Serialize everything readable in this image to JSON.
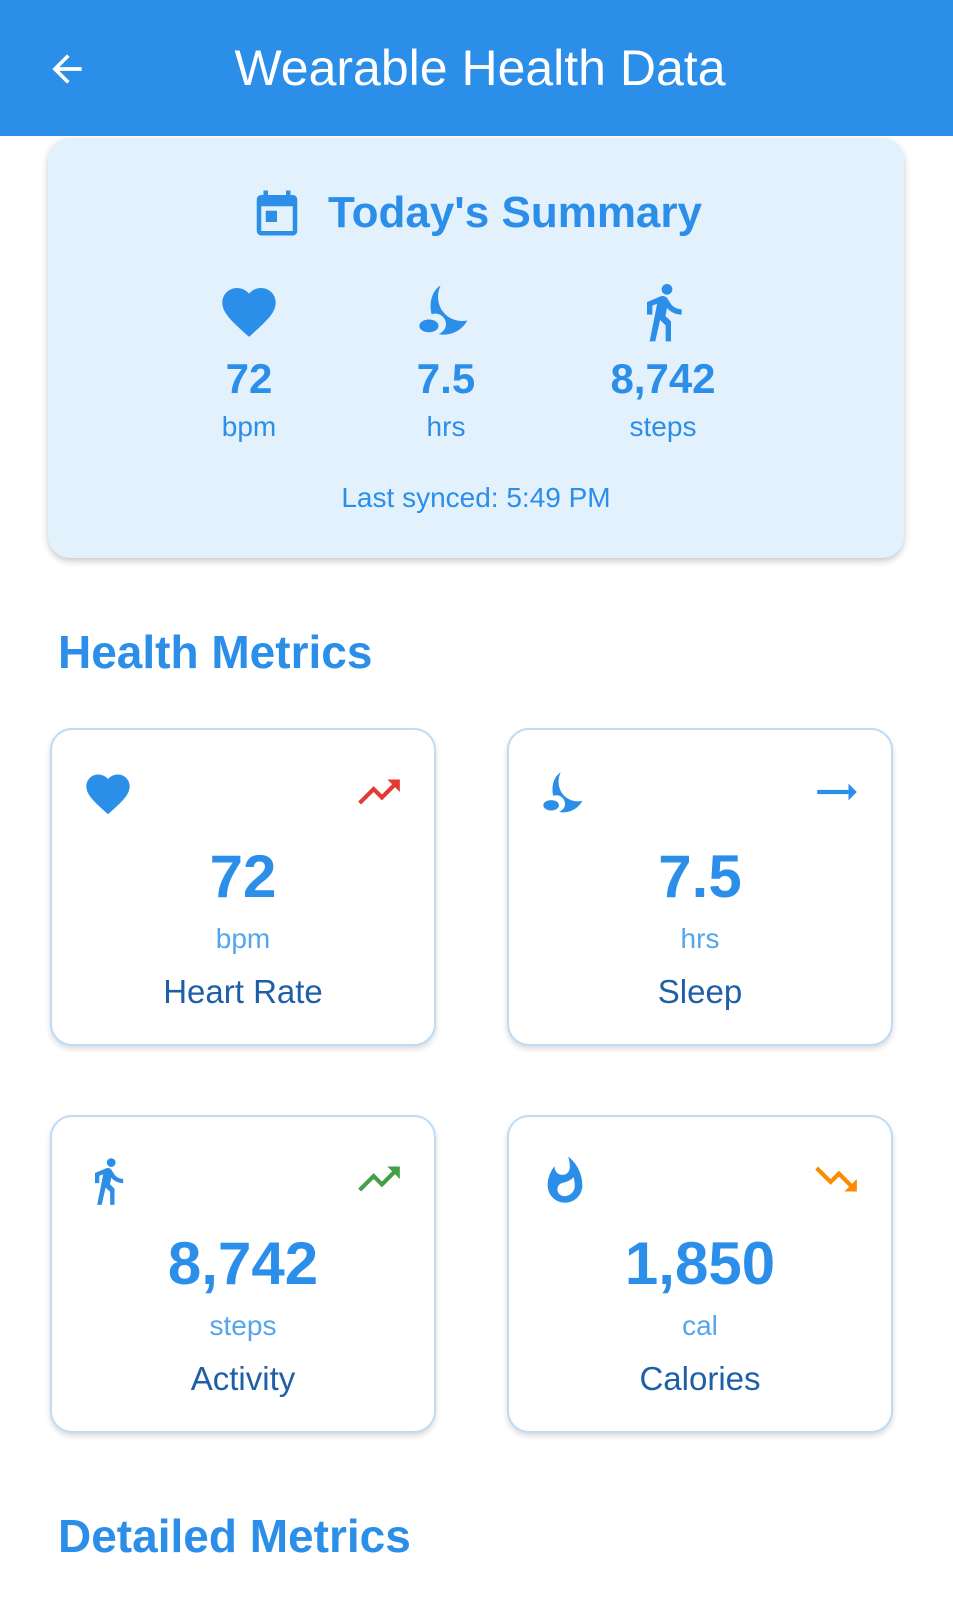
{
  "appbar": {
    "title": "Wearable Health Data"
  },
  "summary": {
    "title": "Today's Summary",
    "stats": [
      {
        "icon": "heart-icon",
        "value": "72",
        "unit": "bpm"
      },
      {
        "icon": "moon-icon",
        "value": "7.5",
        "unit": "hrs"
      },
      {
        "icon": "walking-icon",
        "value": "8,742",
        "unit": "steps"
      }
    ],
    "last_synced": "Last synced: 5:49 PM"
  },
  "health_metrics": {
    "title": "Health Metrics",
    "cards": [
      {
        "icon": "heart-icon",
        "trend": "trending-up-icon",
        "trend_color": "#e53935",
        "value": "72",
        "unit": "bpm",
        "label": "Heart Rate"
      },
      {
        "icon": "moon-icon",
        "trend": "trending-flat-icon",
        "trend_color": "#2b8ee8",
        "value": "7.5",
        "unit": "hrs",
        "label": "Sleep"
      },
      {
        "icon": "walking-icon",
        "trend": "trending-up-icon",
        "trend_color": "#43a047",
        "value": "8,742",
        "unit": "steps",
        "label": "Activity"
      },
      {
        "icon": "fire-icon",
        "trend": "trending-down-icon",
        "trend_color": "#fb8c00",
        "value": "1,850",
        "unit": "cal",
        "label": "Calories"
      }
    ]
  },
  "detailed_metrics": {
    "title": "Detailed Metrics"
  },
  "colors": {
    "primary": "#2b8ee8",
    "summary_bg": "#e3f1fd",
    "label_dark": "#1f5fa8"
  }
}
